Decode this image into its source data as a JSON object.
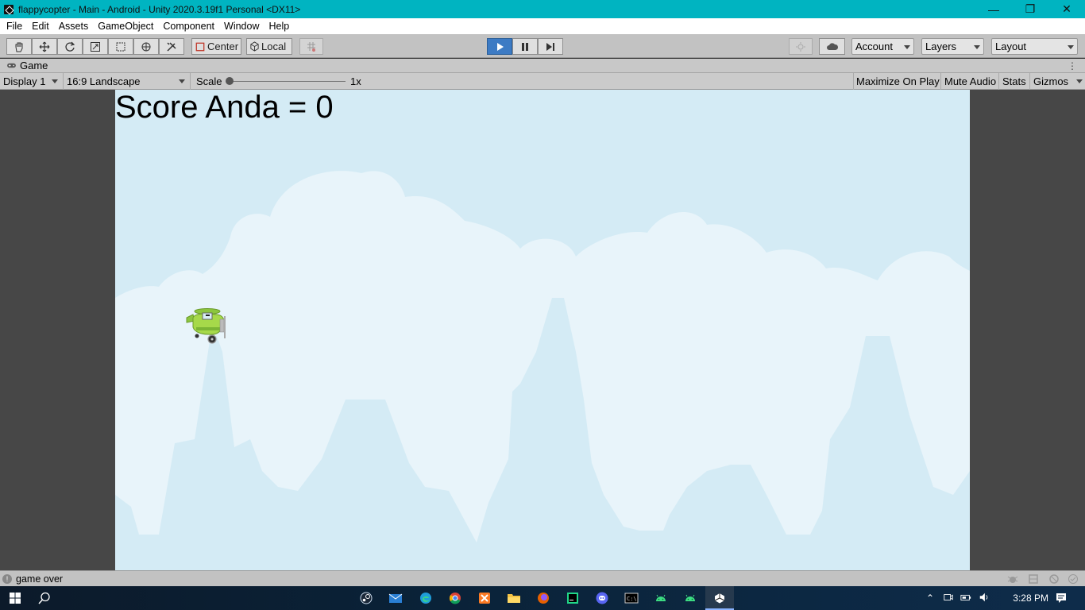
{
  "window": {
    "title": "flappycopter - Main - Android - Unity 2020.3.19f1 Personal <DX11>"
  },
  "menu": [
    "File",
    "Edit",
    "Assets",
    "GameObject",
    "Component",
    "Window",
    "Help"
  ],
  "toolbar": {
    "pivot_label": "Center",
    "space_label": "Local",
    "account_label": "Account",
    "layers_label": "Layers",
    "layout_label": "Layout"
  },
  "tab": {
    "label": "Game"
  },
  "gamebar": {
    "display": "Display 1",
    "aspect": "16:9 Landscape",
    "scale_label": "Scale",
    "scale_value": "1x",
    "scale_level": 0,
    "maximize": "Maximize On Play",
    "mute": "Mute Audio",
    "stats": "Stats",
    "gizmos": "Gizmos"
  },
  "game": {
    "score_text": "Score Anda = 0"
  },
  "status": {
    "message": "game over"
  },
  "taskbar": {
    "time": "3:28 PM",
    "apps": [
      "steam-icon",
      "mail-icon",
      "edge-icon",
      "chrome-icon",
      "xampp-icon",
      "file-explorer-icon",
      "firefox-icon",
      "pycharm-icon",
      "discord-icon",
      "terminal-icon",
      "android-studio-icon",
      "android-studio-icon",
      "unity-icon"
    ]
  },
  "colors": {
    "titlebar": "#00b4c1",
    "sky": "#d4ebf5",
    "cloud": "#e8f4fa",
    "mountain": "#d4ebf5",
    "plane": "#8cc63f",
    "play_active": "#3d7bc4"
  }
}
